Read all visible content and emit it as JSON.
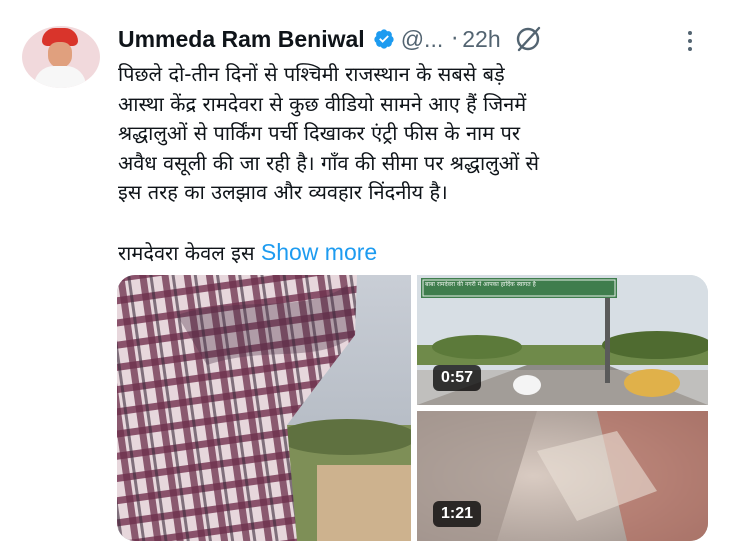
{
  "tweet": {
    "author_name": "Ummeda Ram Beniwal",
    "handle": "@...",
    "separator": "·",
    "time": "22h",
    "text_lines": [
      "पिछले दो-तीन दिनों से पश्चिमी राजस्थान के सबसे बड़े",
      "आस्था केंद्र रामदेवरा से कुछ वीडियो सामने आए हैं जिनमें",
      "श्रद्धालुओं से पार्किंग पर्ची दिखाकर एंट्री फीस के नाम पर",
      "अवैध वसूली की जा रही है। गाँव की सीमा पर श्रद्धालुओं से",
      "इस तरह का उलझाव और व्यवहार निंदनीय है।"
    ],
    "truncated_text": "रामदेवरा केवल इस",
    "show_more": "Show more"
  },
  "icons": {
    "verified": "verified-badge-icon",
    "grok": "grok-icon",
    "more": "more-options-icon"
  },
  "media": {
    "videos": [
      {
        "duration": "0:57",
        "sign_text": "बाबा रामदेवरा की नगरी में आपका हार्दिक स्वागत है"
      },
      {
        "duration": "1:21"
      }
    ]
  },
  "colors": {
    "accent": "#1d9bf0",
    "text": "#0f1419",
    "secondary": "#536471"
  }
}
